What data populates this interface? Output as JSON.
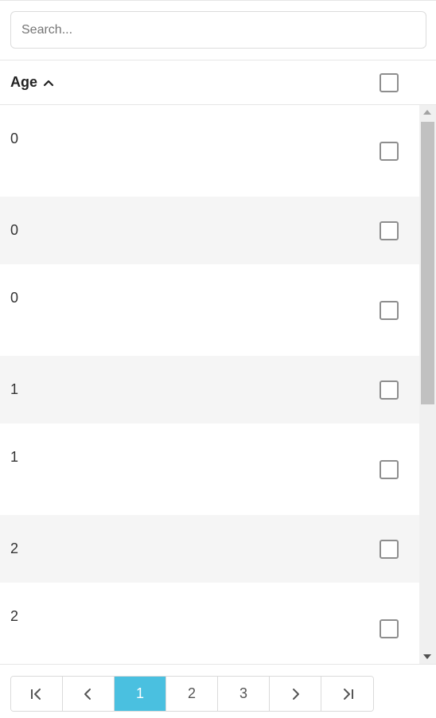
{
  "search": {
    "placeholder": "Search...",
    "value": ""
  },
  "header": {
    "column_label": "Age",
    "sort_direction": "ascending",
    "sort_icon": "chevron-up-icon"
  },
  "rows": [
    {
      "age": "0",
      "checked": false
    },
    {
      "age": "0",
      "checked": false
    },
    {
      "age": "0",
      "checked": false
    },
    {
      "age": "1",
      "checked": false
    },
    {
      "age": "1",
      "checked": false
    },
    {
      "age": "2",
      "checked": false
    },
    {
      "age": "2",
      "checked": false
    }
  ],
  "pager": {
    "first_icon": "first-page-icon",
    "prev_icon": "chevron-left-icon",
    "pages": [
      "1",
      "2",
      "3"
    ],
    "current_page": "1",
    "next_icon": "chevron-right-icon",
    "last_icon": "last-page-icon"
  },
  "colors": {
    "accent": "#4ac0e0",
    "row_alt": "#f5f5f5",
    "checkbox_border": "#8e8e8e"
  }
}
